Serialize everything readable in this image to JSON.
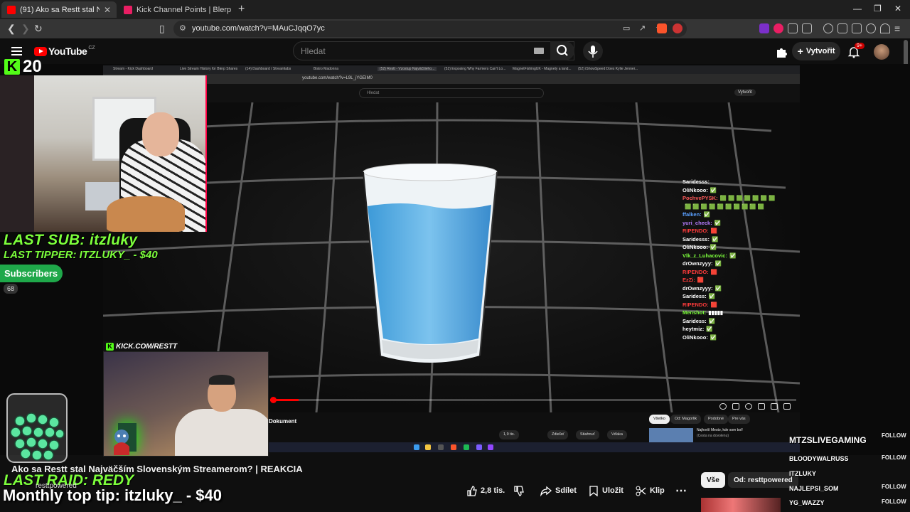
{
  "browser": {
    "tabs": [
      {
        "title": "(91) Ako sa Restt stal Najväčším Slovenským Streamerom? | REAKCIA",
        "active": true,
        "favicon_color": "#ff0000"
      },
      {
        "title": "Kick Channel Points | Blerp",
        "active": false,
        "favicon_color": "#e91e63"
      }
    ],
    "url": "youtube.com/watch?v=MAuCJqqO7yc"
  },
  "youtube": {
    "logo_text": "YouTube",
    "country": "CZ",
    "search_placeholder": "Hledat",
    "create_label": "Vytvořit",
    "notif_badge": "9+"
  },
  "inner_browser": {
    "tabs": [
      "Stream - Kick Dashboard",
      "Live Stream History for Blerp Shares",
      "(14) Dashboard / Streamlabs",
      "Bistro Madonna",
      "(52) Restt - Vzostup Najväčšieho...",
      "(52) Exposing Why Farmers Can't Lo...",
      "MagnetFishingUK - Magnety a land...",
      "(52) iShowSpeed Does Kylie Jenner..."
    ],
    "url": "youtube.com/watch?v=L9L_jYGEIM0",
    "search_placeholder": "Hledat",
    "create_label": "Vytvořit",
    "doc_label": "Dokument",
    "buttons": [
      "1,9 tis.",
      "Zdieľať",
      "Stiahnuť",
      "Vďaka"
    ],
    "chips": [
      "Všetko",
      "Od: Magorlik",
      "Podobné",
      "Pre vás"
    ],
    "side_title": "Najhorší Mesto, kde som bol!",
    "side_sub": "(Cesta na dovolenu)"
  },
  "chat": [
    {
      "user": "Saridesss:",
      "color": "#ffffff",
      "msg": ""
    },
    {
      "user": "OliNkooo:",
      "color": "#ffffff",
      "msg": "✅"
    },
    {
      "user": "PochvePYSK:",
      "color": "#ff5a5a",
      "msg": "🟩 🟩 🟩 🟩 🟩 🟩 🟩"
    },
    {
      "user": "",
      "color": "#7dff3c",
      "msg": "🟩 🟩 🟩 🟩 🟩 🟩 🟩 🟩 🟩 🟩"
    },
    {
      "user": "ffalken:",
      "color": "#5aa0ff",
      "msg": "✅"
    },
    {
      "user": "yuri_check:",
      "color": "#b67dff",
      "msg": "✅"
    },
    {
      "user": "RIPENDO:",
      "color": "#ff3b3b",
      "msg": "🟥"
    },
    {
      "user": "Saridesss:",
      "color": "#ffffff",
      "msg": "✅"
    },
    {
      "user": "OliNkooo:",
      "color": "#ffffff",
      "msg": "✅"
    },
    {
      "user": "Vlk_z_Luhacovic:",
      "color": "#7dff3c",
      "msg": "✅"
    },
    {
      "user": "drOwnzyyy:",
      "color": "#ffffff",
      "msg": "✅"
    },
    {
      "user": "RIPENDO:",
      "color": "#ff3b3b",
      "msg": "🟥"
    },
    {
      "user": "EzZi:",
      "color": "#ff3b3b",
      "msg": "🟥"
    },
    {
      "user": "drOwnzyyy:",
      "color": "#ffffff",
      "msg": "✅"
    },
    {
      "user": "Saridess:",
      "color": "#ffffff",
      "msg": "✅"
    },
    {
      "user": "RIPENDO:",
      "color": "#ff3b3b",
      "msg": "🟥"
    },
    {
      "user": "Menshot:",
      "color": "#7dff3c",
      "msg": "▮▮▮▮▮"
    },
    {
      "user": "Saridess:",
      "color": "#ffffff",
      "msg": "✅"
    },
    {
      "user": "heytmiz:",
      "color": "#ffffff",
      "msg": "✅"
    },
    {
      "user": "OliNkooo:",
      "color": "#ffffff",
      "msg": "✅"
    }
  ],
  "overlay": {
    "kick_letter": "K",
    "kick_count": "20",
    "last_sub": "LAST SUB: itzluky",
    "last_tipper": "LAST TIPPER: ITZLUKY_ - $40",
    "subscribers_label": "Subscribers",
    "subscribers_count": "68",
    "kick_url": "KICK.COM/RESTT",
    "last_raid": "LAST RAID: REDY",
    "monthly_top_tip": "Monthly top tip: itzluky_ - $40"
  },
  "video": {
    "title": "Ako sa Restt stal Najväčším Slovenským Streamerom? | REAKCIA",
    "channel": "resttpowered",
    "likes": "2,8 tis.",
    "share_label": "Sdílet",
    "save_label": "Uložit",
    "clip_label": "Klip",
    "more_label": "⋯"
  },
  "sidebar_chips": [
    {
      "label": "Vše",
      "selected": true
    },
    {
      "label": "Od: resttpowered",
      "selected": false
    }
  ],
  "followers": [
    {
      "name": "MTZSLIVEGAMING",
      "tag": "FOLLOW"
    },
    {
      "name": "BLOODYWALRUSS",
      "tag": "FOLLOW"
    },
    {
      "name": "ITZLUKY",
      "tag": ""
    },
    {
      "name": "NAJLEPSI_SOM",
      "tag": "FOLLOW"
    },
    {
      "name": "YG_WAZZY",
      "tag": "FOLLOW"
    }
  ],
  "colors": {
    "accent_green": "#7dff3c",
    "kick_green": "#53fc18",
    "yt_red": "#ff0000"
  }
}
